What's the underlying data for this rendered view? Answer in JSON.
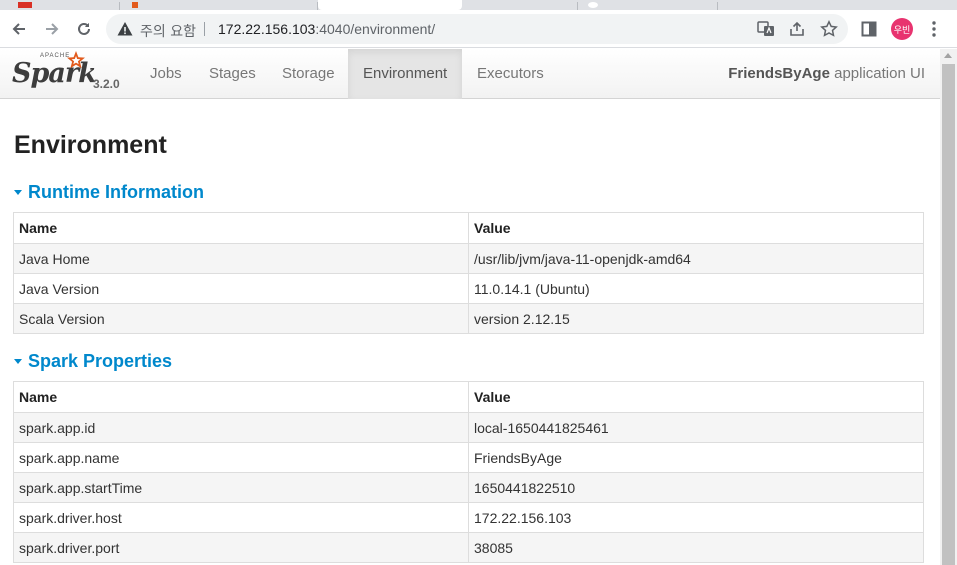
{
  "browser": {
    "tabs": [
      "",
      "",
      "",
      "",
      ""
    ],
    "omnibox": {
      "security_label": "주의 요함",
      "url_host": "172.22.156.103",
      "url_path": ":4040/environment/"
    },
    "profile_initials": "우빈",
    "icons": [
      "back-icon",
      "forward-icon",
      "reload-icon",
      "warning-icon",
      "translate-icon",
      "share-icon",
      "star-icon",
      "side-panel-icon",
      "profile-avatar",
      "kebab-menu-icon"
    ]
  },
  "navbar": {
    "brand": {
      "apache": "APACHE",
      "name": "Spark",
      "version": "3.2.0"
    },
    "links": [
      {
        "label": "Jobs",
        "active": false
      },
      {
        "label": "Stages",
        "active": false
      },
      {
        "label": "Storage",
        "active": false
      },
      {
        "label": "Environment",
        "active": true
      },
      {
        "label": "Executors",
        "active": false
      }
    ],
    "app_name": "FriendsByAge",
    "app_suffix": " application UI"
  },
  "page": {
    "title": "Environment",
    "sections": [
      {
        "heading": "Runtime Information",
        "columns": [
          "Name",
          "Value"
        ],
        "rows": [
          [
            "Java Home",
            "/usr/lib/jvm/java-11-openjdk-amd64"
          ],
          [
            "Java Version",
            "11.0.14.1 (Ubuntu)"
          ],
          [
            "Scala Version",
            "version 2.12.15"
          ]
        ]
      },
      {
        "heading": "Spark Properties",
        "columns": [
          "Name",
          "Value"
        ],
        "rows": [
          [
            "spark.app.id",
            "local-1650441825461"
          ],
          [
            "spark.app.name",
            "FriendsByAge"
          ],
          [
            "spark.app.startTime",
            "1650441822510"
          ],
          [
            "spark.driver.host",
            "172.22.156.103"
          ],
          [
            "spark.driver.port",
            "38085"
          ]
        ]
      }
    ]
  },
  "colors": {
    "section_heading": "#0088cc",
    "spark_star": "#e25a1c",
    "profile_bg": "#e8336f"
  }
}
